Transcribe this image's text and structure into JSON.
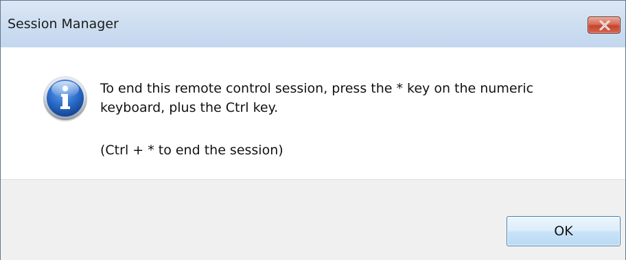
{
  "window": {
    "title": "Session Manager",
    "close_icon": "close-icon"
  },
  "message": {
    "icon": "info-icon",
    "line1": "To end this remote control session, press the * key on the numeric keyboard, plus the Ctrl key.",
    "line2": "(Ctrl + * to end the session)"
  },
  "buttons": {
    "ok_label": "OK"
  },
  "colors": {
    "titlebar": "#cfdff1",
    "close_button": "#c5432e",
    "footer": "#f0f0f0",
    "ok_border": "#3c7fb1",
    "info_icon": "#1f5fb8"
  }
}
